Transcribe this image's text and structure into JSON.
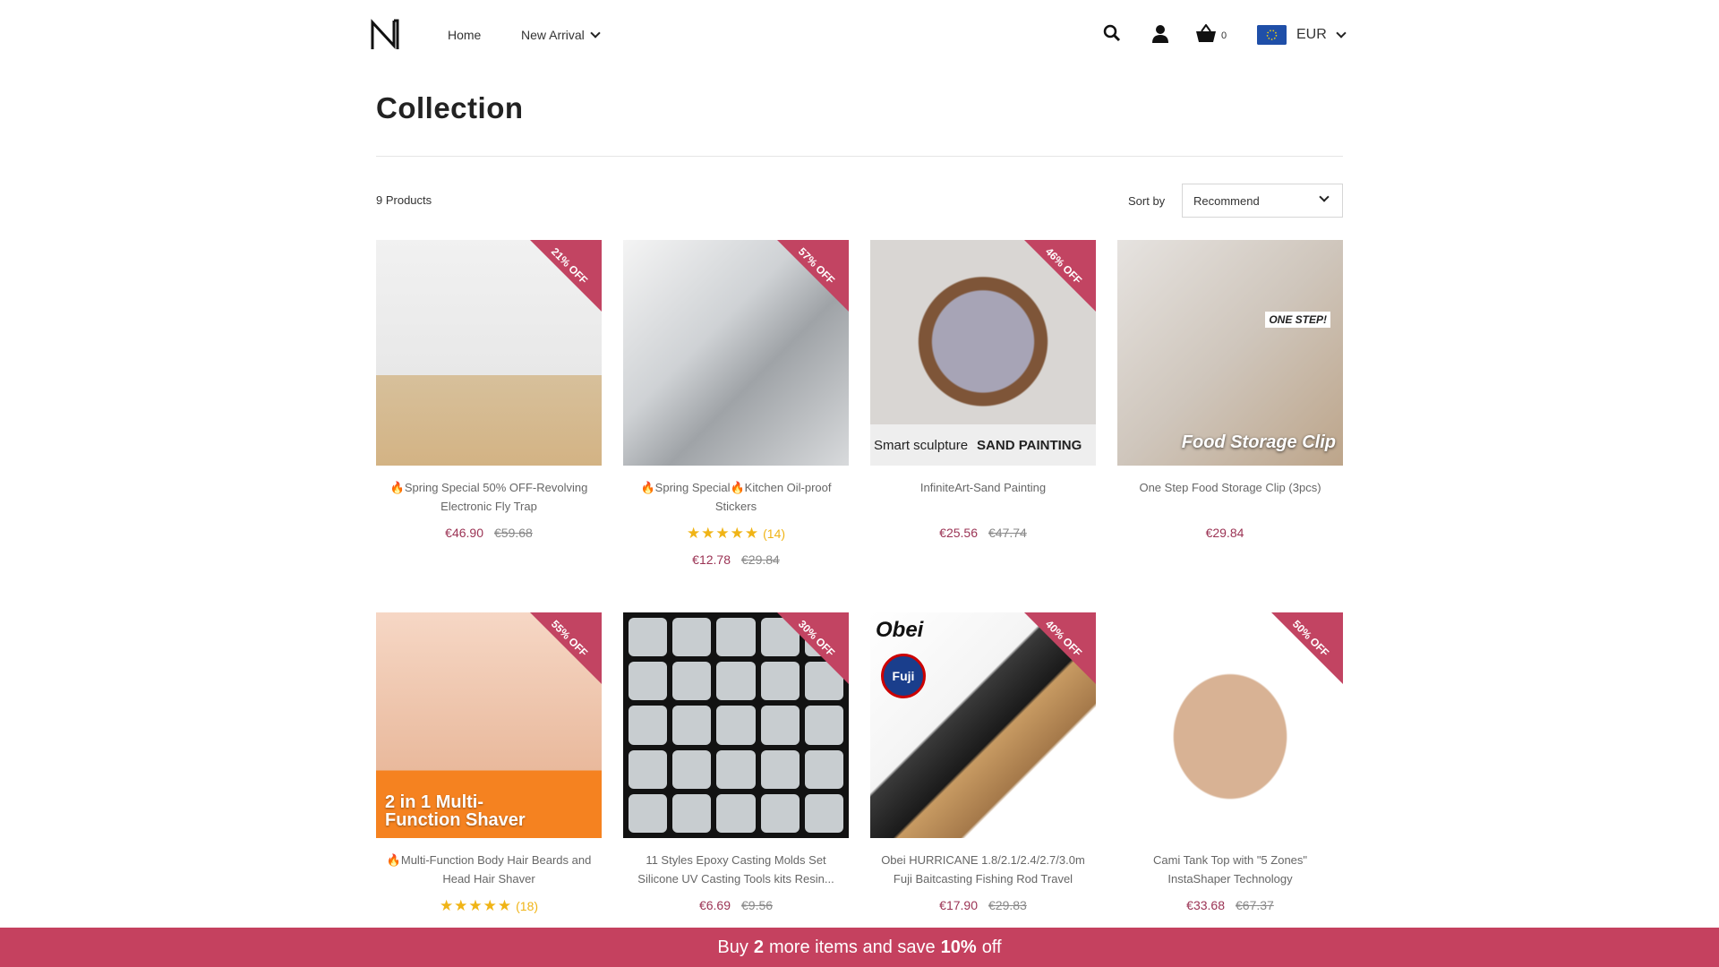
{
  "header": {
    "nav": {
      "home": "Home",
      "new_arrival": "New Arrival"
    },
    "cart_count": "0",
    "currency": "EUR"
  },
  "page": {
    "title": "Collection",
    "product_count": "9 Products",
    "sort_label": "Sort by",
    "sort_value": "Recommend"
  },
  "products": [
    {
      "name": "🔥Spring Special 50% OFF-Revolving Electronic Fly Trap",
      "price": "€46.90",
      "old_price": "€59.68",
      "discount": "21% OFF"
    },
    {
      "name": "🔥Spring Special🔥Kitchen Oil-proof Stickers",
      "price": "€12.78",
      "old_price": "€29.84",
      "discount": "57% OFF",
      "stars": "★★★★★",
      "reviews": "(14)"
    },
    {
      "name": "InfiniteArt-Sand Painting",
      "price": "€25.56",
      "old_price": "€47.74",
      "discount": "46% OFF",
      "image_text": {
        "left": "Smart sculpture",
        "right": "SAND PAINTING"
      }
    },
    {
      "name": "One Step Food Storage Clip (3pcs)",
      "price": "€29.84",
      "image_text": {
        "tag": "ONE STEP!",
        "label": "Food Storage Clip"
      }
    },
    {
      "name": "🔥Multi-Function Body Hair Beards and Head Hair Shaver",
      "discount": "55% OFF",
      "stars": "★★★★★",
      "reviews": "(18)",
      "image_text": {
        "label": "2 in 1 Multi-Function Shaver"
      }
    },
    {
      "name": "11 Styles Epoxy Casting Molds Set Silicone UV Casting Tools kits Resin...",
      "price": "€6.69",
      "old_price": "€9.56",
      "discount": "30% OFF"
    },
    {
      "name": "Obei HURRICANE 1.8/2.1/2.4/2.7/3.0m Fuji Baitcasting Fishing Rod Travel Ultr...",
      "price": "€17.90",
      "old_price": "€29.83",
      "discount": "40% OFF",
      "image_text": {
        "brand": "Obei",
        "badge": "Fuji"
      }
    },
    {
      "name": "Cami Tank Top with \"5 Zones\" InstaShaper Technology",
      "price": "€33.68",
      "old_price": "€67.37",
      "discount": "50% OFF"
    }
  ],
  "promo": {
    "prefix": "Buy",
    "count": "2",
    "middle": "more items and save",
    "percent": "10%",
    "suffix": "off"
  },
  "colors": {
    "accent": "#c5415f",
    "price": "#9b3354",
    "star": "#f0b416"
  },
  "icons": [
    "logo-icon",
    "search-icon",
    "user-icon",
    "cart-icon",
    "eu-flag-icon",
    "chevron-down-icon",
    "star-icon"
  ]
}
